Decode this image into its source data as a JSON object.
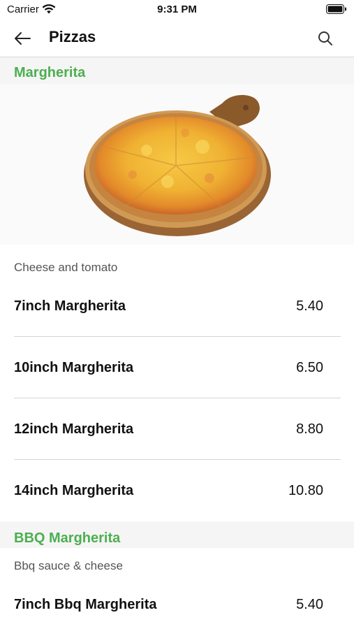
{
  "status_bar": {
    "carrier": "Carrier",
    "time": "9:31 PM",
    "icons": [
      "wifi-icon",
      "battery-icon"
    ]
  },
  "nav": {
    "title": "Pizzas",
    "back_icon": "arrow-left-icon",
    "search_icon": "search-icon"
  },
  "colors": {
    "accent": "#4caf50",
    "section_bg": "#f5f5f5",
    "divider": "#d5d5d5"
  },
  "sections": [
    {
      "title": "Margherita",
      "image": "margherita-pizza-image",
      "description": "Cheese and tomato",
      "items": [
        {
          "name": "7inch Margherita",
          "price": "5.40"
        },
        {
          "name": "10inch Margherita",
          "price": "6.50"
        },
        {
          "name": "12inch Margherita",
          "price": "8.80"
        },
        {
          "name": "14inch Margherita",
          "price": "10.80"
        }
      ]
    },
    {
      "title": "BBQ Margherita",
      "description": "Bbq sauce & cheese",
      "items": [
        {
          "name": "7inch Bbq Margherita",
          "price": "5.40"
        }
      ]
    }
  ]
}
